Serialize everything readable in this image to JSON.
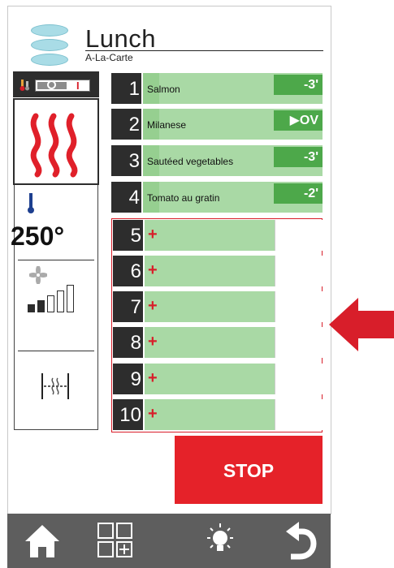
{
  "header": {
    "title": "Lunch",
    "subtitle": "A-La-Carte"
  },
  "mode": {
    "switch_off_label": "O",
    "switch_on_label": "I"
  },
  "temperature": {
    "value": "250°"
  },
  "fan_level": 2,
  "programs": [
    {
      "number": "1",
      "name": "Salmon",
      "time": "-3'"
    },
    {
      "number": "2",
      "name": "Milanese",
      "time": "▶OV"
    },
    {
      "number": "3",
      "name": "Sautéed vegetables",
      "time": "-3'"
    },
    {
      "number": "4",
      "name": "Tomato au gratin",
      "time": "-2'"
    }
  ],
  "empty_slots": [
    {
      "number": "5",
      "add": "+"
    },
    {
      "number": "6",
      "add": "+"
    },
    {
      "number": "7",
      "add": "+"
    },
    {
      "number": "8",
      "add": "+"
    },
    {
      "number": "9",
      "add": "+"
    },
    {
      "number": "10",
      "add": "+"
    }
  ],
  "actions": {
    "stop_label": "STOP"
  },
  "colors": {
    "accent_red": "#e52229",
    "row_green": "#a9d9a5",
    "badge_green": "#4da84a",
    "dark": "#2d2d2d",
    "navbar": "#5e5e5e"
  },
  "navbar": {
    "items": [
      "home-icon",
      "grid-add-icon",
      "light-icon",
      "back-icon"
    ]
  }
}
